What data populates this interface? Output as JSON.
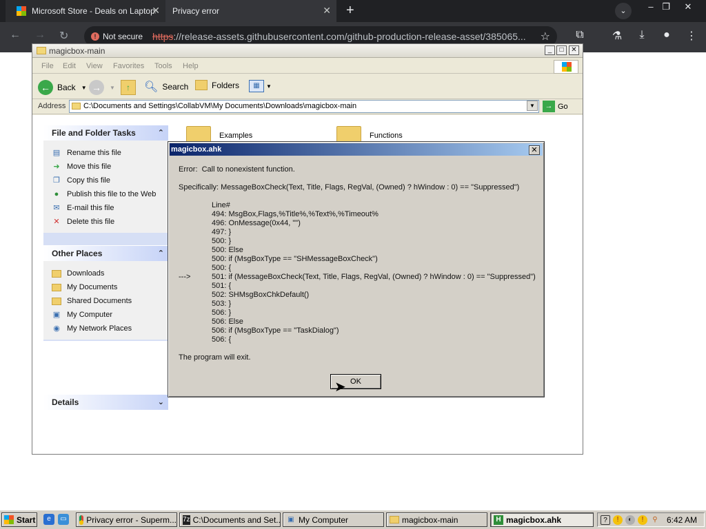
{
  "chrome": {
    "tabs": [
      {
        "title": "Microsoft Store - Deals on Laptops"
      },
      {
        "title": "Privacy error"
      }
    ],
    "new_tab_label": "+",
    "security_badge": "Not secure",
    "url_scheme": "https",
    "url_rest": "://release-assets.githubusercontent.com/github-production-release-asset/385065..."
  },
  "explorer": {
    "title": "magicbox-main",
    "menu": [
      "File",
      "Edit",
      "View",
      "Favorites",
      "Tools",
      "Help"
    ],
    "toolbar": {
      "back": "Back",
      "search": "Search",
      "folders": "Folders"
    },
    "address_label": "Address",
    "address": "C:\\Documents and Settings\\CollabVM\\My Documents\\Downloads\\magicbox-main",
    "go": "Go",
    "panels": {
      "tasks": {
        "title": "File and Folder Tasks",
        "items": [
          "Rename this file",
          "Move this file",
          "Copy this file",
          "Publish this file to the Web",
          "E-mail this file",
          "Delete this file"
        ]
      },
      "places": {
        "title": "Other Places",
        "items": [
          "Downloads",
          "My Documents",
          "Shared Documents",
          "My Computer",
          "My Network Places"
        ]
      },
      "details": {
        "title": "Details"
      }
    },
    "folders": [
      "Examples",
      "Functions"
    ]
  },
  "dialog": {
    "title": "magicbox.ahk",
    "error": "Error:  Call to nonexistent function.",
    "specifically": "Specifically: MessageBoxCheck(Text, Title, Flags, RegVal, (Owned) ? hWindow : 0) == \"Suppressed\")",
    "line_header": "Line#",
    "arrow": "--->",
    "lines": [
      "494: MsgBox,Flags,%Title%,%Text%,%Timeout%",
      "496: OnMessage(0x44, \"\")",
      "497: }",
      "500: }",
      "500: Else",
      "500: if (MsgBoxType == \"SHMessageBoxCheck\")",
      "500: {",
      "501: if (MessageBoxCheck(Text, Title, Flags, RegVal, (Owned) ? hWindow : 0) == \"Suppressed\")",
      "501: {",
      "502: SHMsgBoxChkDefault()",
      "503: }",
      "506: }",
      "506: Else",
      "506: if (MsgBoxType == \"TaskDialog\")",
      "506: {"
    ],
    "footer": "The program will exit.",
    "ok": "OK"
  },
  "taskbar": {
    "start": "Start",
    "tasks": [
      {
        "label": "Privacy error - Superm..."
      },
      {
        "label": "C:\\Documents and Set..."
      },
      {
        "label": "My Computer"
      },
      {
        "label": "magicbox-main"
      },
      {
        "label": "magicbox.ahk"
      }
    ],
    "clock": "6:42 AM"
  }
}
